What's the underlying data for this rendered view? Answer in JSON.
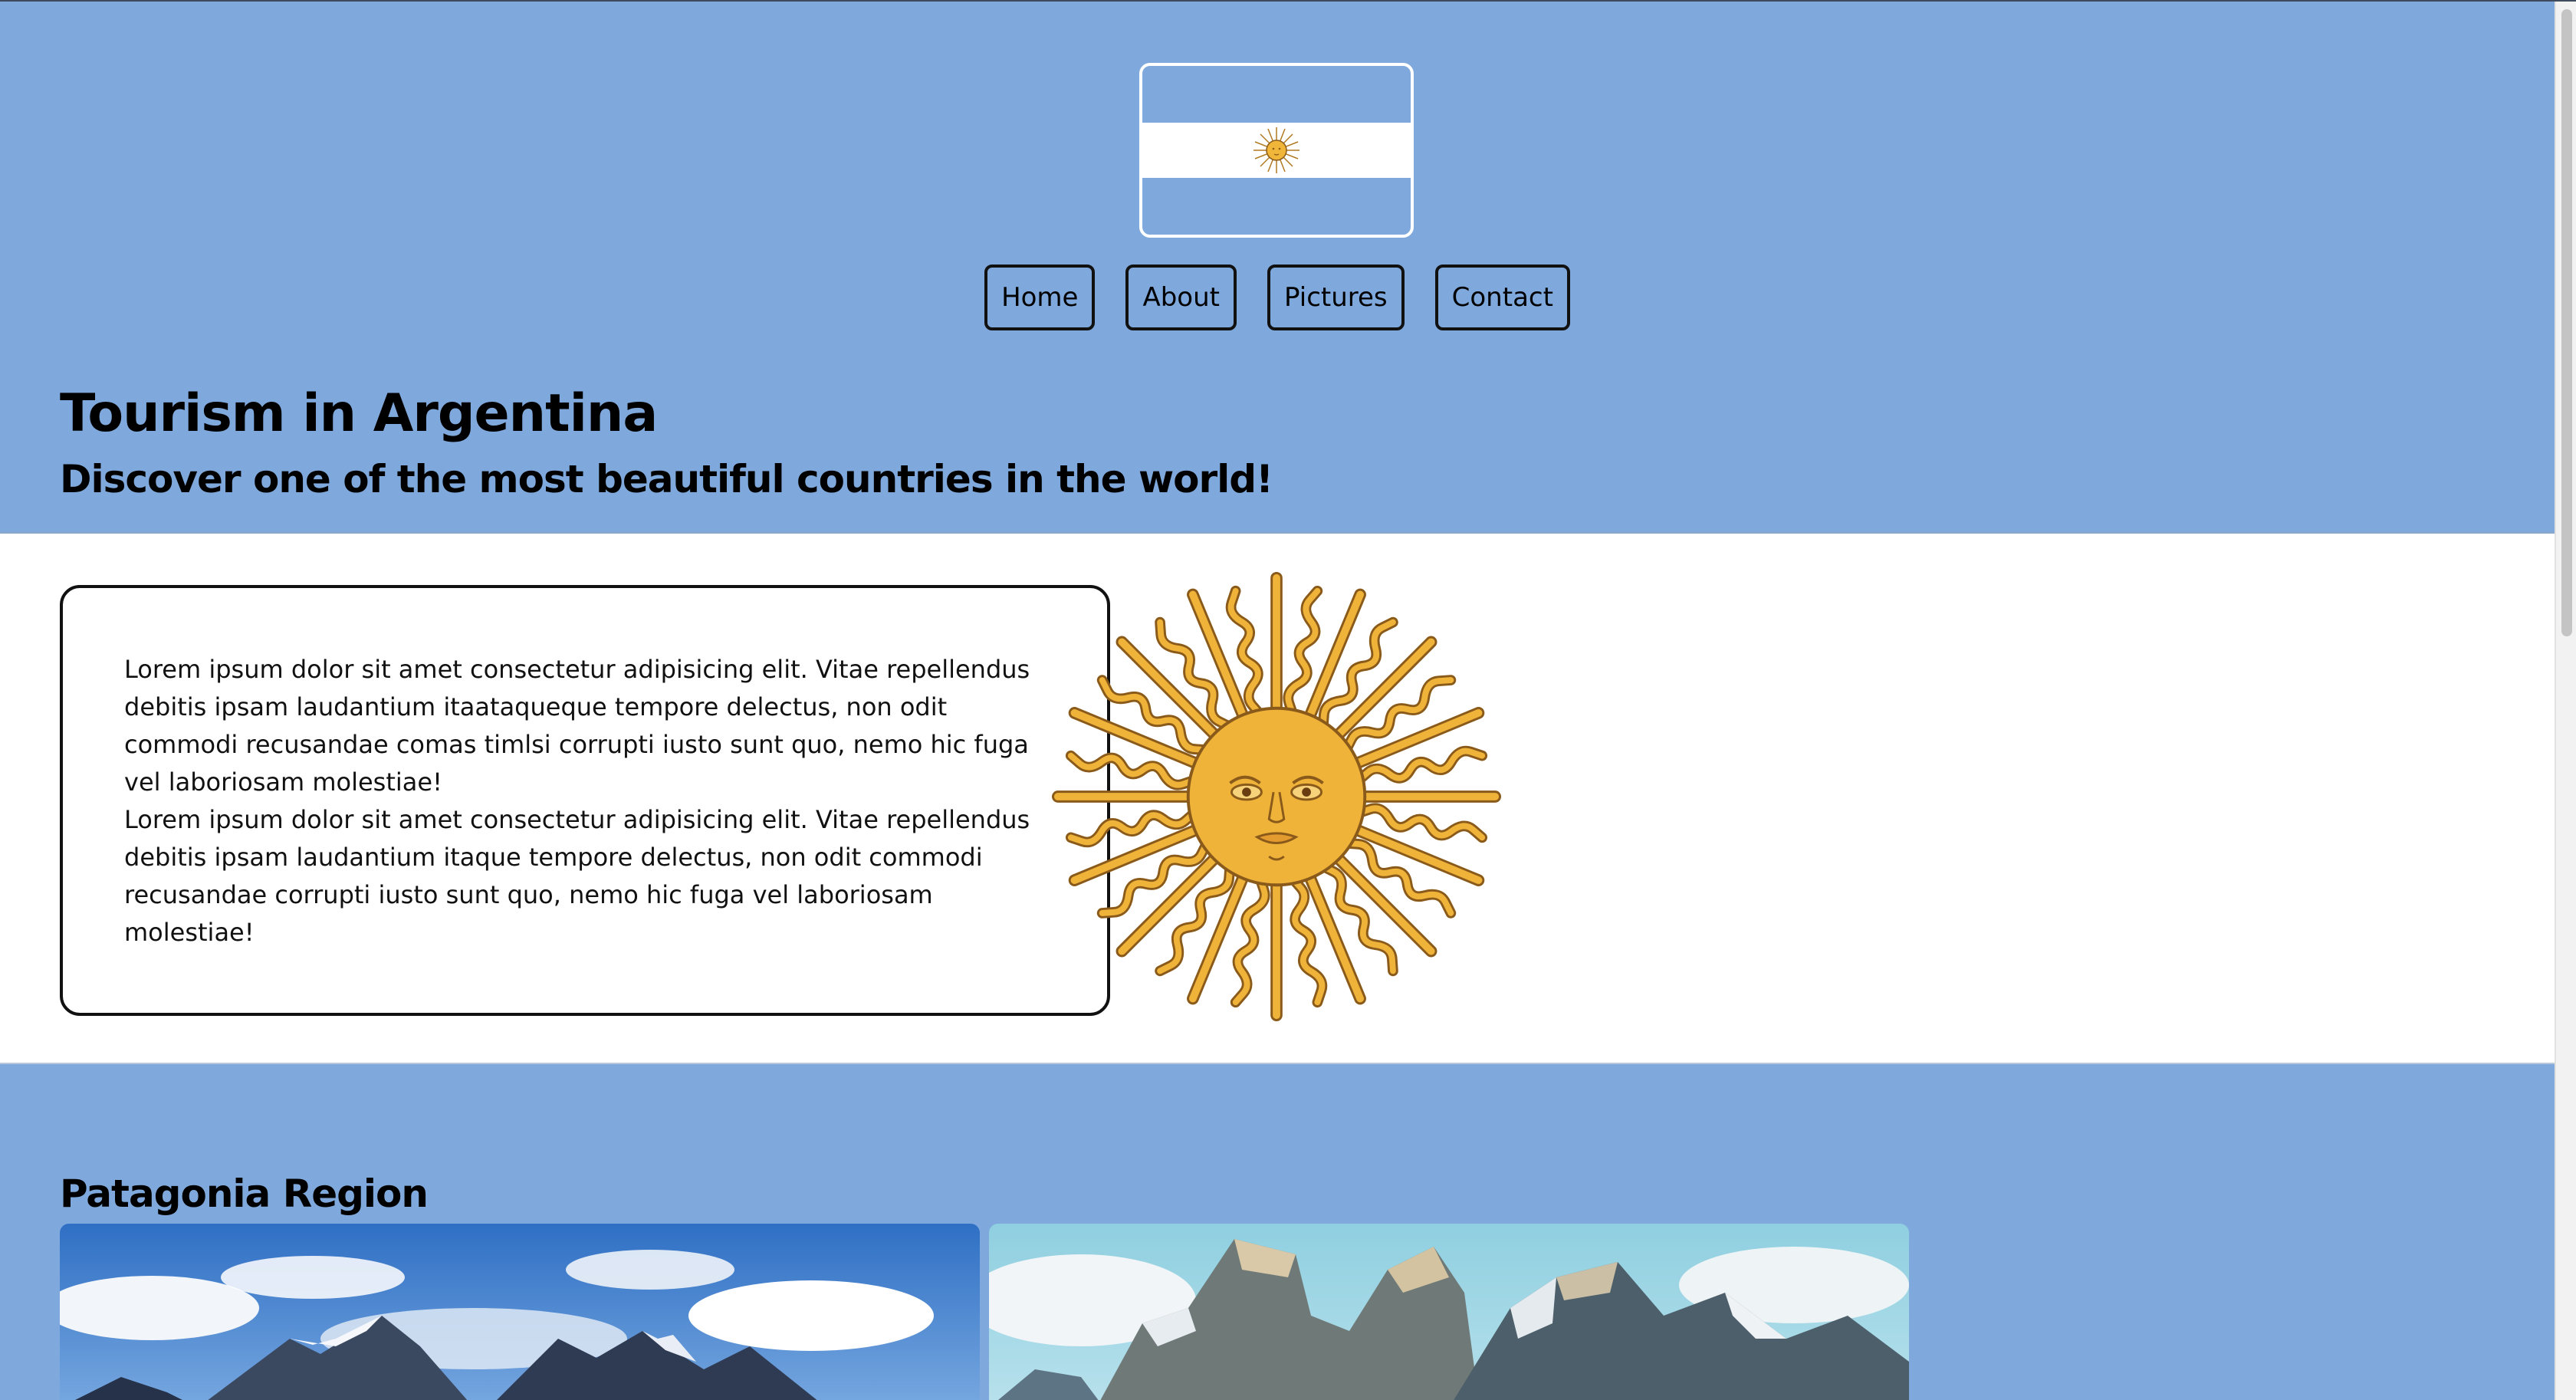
{
  "header": {
    "flag_alt": "Argentina flag",
    "nav": [
      {
        "label": "Home"
      },
      {
        "label": "About"
      },
      {
        "label": "Pictures"
      },
      {
        "label": "Contact"
      }
    ],
    "title": "Tourism in Argentina",
    "subtitle": "Discover one of the most beautiful countries in the world!"
  },
  "intro": {
    "paragraph_1": "Lorem ipsum dolor sit amet consectetur adipisicing elit. Vitae repellendus debitis ipsam laudantium itaataqueque tempore delectus, non odit commodi recusandae comas timlsi corrupti iusto sunt quo, nemo hic fuga vel laboriosam molestiae!",
    "paragraph_2": "Lorem ipsum dolor sit amet consectetur adipisicing elit. Vitae repellendus debitis ipsam laudantium itaque tempore delectus, non odit commodi recusandae corrupti iusto sunt quo, nemo hic fuga vel laboriosam molestiae!",
    "sun_image": "sun-of-may-icon"
  },
  "patagonia": {
    "title": "Patagonia Region",
    "photos": [
      "mountain-landscape-image",
      "torres-del-paine-image"
    ]
  },
  "colors": {
    "sky_blue": "#7fa9dc",
    "sun_gold": "#f0b63a",
    "sun_outline": "#8a5a1a"
  }
}
